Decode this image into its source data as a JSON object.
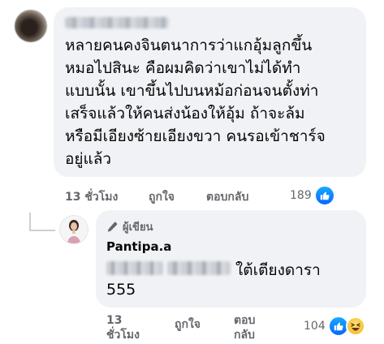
{
  "comment": {
    "text": "หลายคนคงจินตนาการว่าแกอุ้มลูกขึ้น\nหมอไปสินะ คือผมคิดว่าเขาไม่ได้ทำ\nแบบนั้น เขาขึ้นไปบนหม้อก่อนจนตั้งท่า\nเสร็จแล้วให้คนส่งน้องให้อุ้ม ถ้าจะล้ม\nหรือมีเอียงซ้ายเอียงขวา คนรอเข้าชาร์จ\nอยู่แล้ว",
    "time": "13 ชั่วโมง",
    "like_label": "ถูกใจ",
    "reply_label": "ตอบกลับ",
    "reaction_count": "189",
    "reaction_icons": [
      "like-icon"
    ]
  },
  "reply": {
    "author_badge": "ผู้เขียน",
    "author_name": "Pantipa.a",
    "text_line1": "ใต้เตียงดารา",
    "text_line2": "555",
    "time": "13 ชั่วโมง",
    "like_label": "ถูกใจ",
    "reply_label": "ตอบกลับ",
    "reaction_count": "104",
    "reaction_icons": [
      "like-icon",
      "haha-icon"
    ]
  },
  "colors": {
    "bubble": "#f0f2f5",
    "secondary_text": "#65676b",
    "like_blue": "#0866ff",
    "haha_yellow": "#f7b928"
  }
}
